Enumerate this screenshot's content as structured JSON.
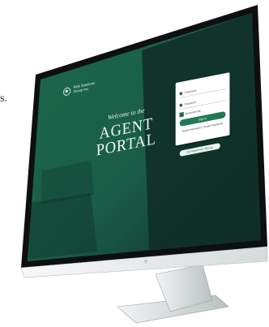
{
  "page": {
    "fragment": "s."
  },
  "brand": {
    "line1": "Risk Solutions",
    "line2": "Group Inc."
  },
  "hero": {
    "welcome": "Welcome to the",
    "title_line1": "AGENT",
    "title_line2": "PORTAL"
  },
  "login": {
    "username_placeholder": "Username",
    "password_placeholder": "Password",
    "remember_label": "Remember Me",
    "signin_label": "Sign In",
    "forgot_text": "Forgot Username? | Forgot Password?",
    "secondary_cta": "Not Registered? Sign Up"
  },
  "colors": {
    "screen_dark": "#0f2d27",
    "screen_green": "#1b6a4d",
    "accent": "#1f7a52",
    "bezel": "#0d0f10",
    "chin": "#e9ecec",
    "stand": "#cfd5d5"
  },
  "icons": {
    "user": "user-icon",
    "lock": "lock-icon",
    "logo": "logo-icon"
  }
}
